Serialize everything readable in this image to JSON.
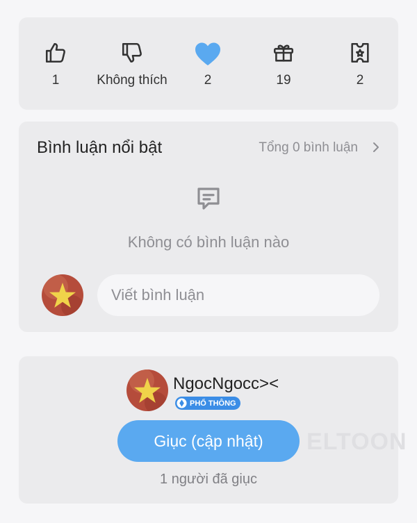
{
  "reactions": {
    "like": {
      "count": "1",
      "icon": "thumbs-up-icon"
    },
    "dislike": {
      "label": "Không thích",
      "icon": "thumbs-down-icon"
    },
    "love": {
      "count": "2",
      "icon": "heart-icon",
      "color": "#5aa9f0"
    },
    "gift": {
      "count": "19",
      "icon": "gift-icon"
    },
    "ticket": {
      "count": "2",
      "icon": "star-ticket-icon"
    }
  },
  "comments": {
    "title": "Bình luận nổi bật",
    "total_label": "Tổng 0 bình luận",
    "empty_text": "Không có bình luận nào",
    "input_placeholder": "Viết bình luận"
  },
  "author": {
    "name": "NgocNgocc><",
    "badge": "PHỔ THÔNG",
    "urge_button": "Giục (cập nhật)",
    "urge_count": "1 người đã giục",
    "watermark": "ELTOON"
  },
  "colors": {
    "accent": "#5aa9f0",
    "badge": "#3b8de6",
    "card": "#ebebed",
    "background": "#f6f6f8"
  }
}
